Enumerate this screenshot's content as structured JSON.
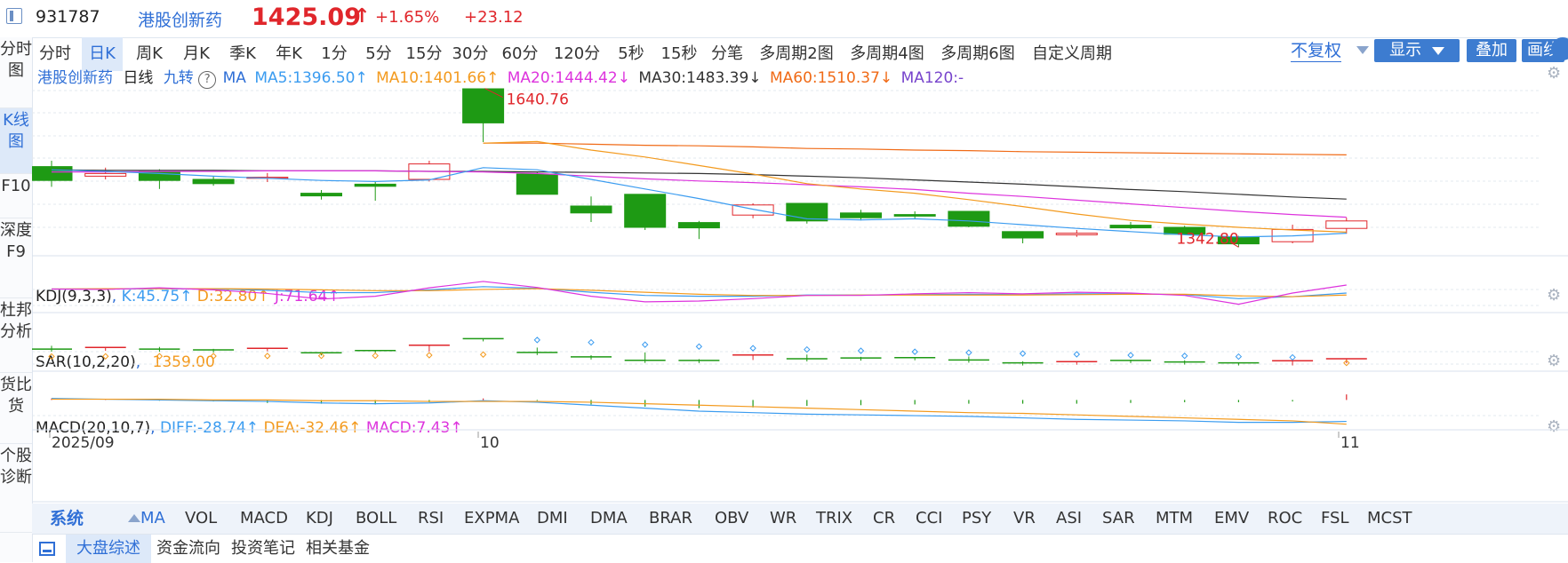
{
  "header": {
    "code": "931787",
    "name": "港股创新药",
    "price": "1425.09",
    "price_arrow": "↑",
    "change_pct": "+1.65%",
    "change_abs": "+23.12"
  },
  "left_nav": [
    "分时图",
    "K线图",
    "F10",
    "深度F9",
    "杜邦分析",
    "货比货",
    "个股诊断"
  ],
  "period_tabs": [
    "分时",
    "日K",
    "周K",
    "月K",
    "季K",
    "年K",
    "1分",
    "5分",
    "15分",
    "30分",
    "60分",
    "120分",
    "5秒",
    "15秒",
    "分笔",
    "多周期2图",
    "多周期4图",
    "多周期6图",
    "自定义周期"
  ],
  "active_period": "日K",
  "toolbar": {
    "fuquan": "不复权",
    "display": "显示",
    "overlay": "叠加",
    "draw": "画线"
  },
  "main_legend": {
    "name": "港股创新药",
    "period": "日线",
    "jiuzhuan": "九转",
    "help": "?",
    "ma": "MA",
    "ma5": "MA5:1396.50↑",
    "ma10": "MA10:1401.66↑",
    "ma20": "MA20:1444.42↓",
    "ma30": "MA30:1483.39↓",
    "ma60": "MA60:1510.37↓",
    "ma120": "MA120:-",
    "high_label": "1640.76",
    "low_label": "1342.80"
  },
  "kdj_legend": {
    "name": "KDJ(9,3,3)",
    "sep": ",",
    "k": "K:45.75↑",
    "d": "D:32.80↑",
    "j": "J:71.64↑"
  },
  "sar_legend": {
    "name": "SAR(10,2,20)",
    "sep": ",",
    "value": "1359.00"
  },
  "macd_legend": {
    "name": "MACD(20,10,7)",
    "sep": ",",
    "diff": "DIFF:-28.74↑",
    "dea": "DEA:-32.46↑",
    "macd": "MACD:7.43↑"
  },
  "x_axis": [
    "2025/09",
    "10",
    "11"
  ],
  "indicator_tabs": [
    "MA",
    "VOL",
    "MACD",
    "KDJ",
    "BOLL",
    "RSI",
    "EXPMA",
    "DMI",
    "DMA",
    "BRAR",
    "OBV",
    "WR",
    "TRIX",
    "CR",
    "CCI",
    "PSY",
    "VR",
    "ASI",
    "SAR",
    "MTM",
    "EMV",
    "ROC",
    "FSL",
    "MCST"
  ],
  "system_label": "系统",
  "bottom_tabs": [
    "大盘综述",
    "资金流向",
    "投资笔记",
    "相关基金"
  ],
  "colors": {
    "up": "#e0262b",
    "down": "#1e9a14",
    "ma5": "#3b9cf0",
    "ma10": "#f39a1e",
    "ma20": "#dd33dd",
    "ma30": "#333333",
    "ma60": "#f06a16",
    "ma120": "#7744cc",
    "accent": "#2f6fd6"
  },
  "chart_data": {
    "type": "candlestick",
    "price_range": [
      1330,
      1650
    ],
    "candles": [
      {
        "o": 1494,
        "h": 1505,
        "l": 1456,
        "c": 1468
      },
      {
        "o": 1476,
        "h": 1492,
        "l": 1470,
        "c": 1481
      },
      {
        "o": 1485,
        "h": 1489,
        "l": 1452,
        "c": 1468
      },
      {
        "o": 1470,
        "h": 1476,
        "l": 1458,
        "c": 1462
      },
      {
        "o": 1472,
        "h": 1482,
        "l": 1465,
        "c": 1474
      },
      {
        "o": 1444,
        "h": 1450,
        "l": 1432,
        "c": 1439
      },
      {
        "o": 1461,
        "h": 1465,
        "l": 1430,
        "c": 1457
      },
      {
        "o": 1470,
        "h": 1505,
        "l": 1466,
        "c": 1499
      },
      {
        "o": 1640,
        "h": 1640.76,
        "l": 1540,
        "c": 1576
      },
      {
        "o": 1480,
        "h": 1485,
        "l": 1442,
        "c": 1442
      },
      {
        "o": 1420,
        "h": 1438,
        "l": 1390,
        "c": 1407
      },
      {
        "o": 1442,
        "h": 1442,
        "l": 1375,
        "c": 1380
      },
      {
        "o": 1389,
        "h": 1392,
        "l": 1358,
        "c": 1379
      },
      {
        "o": 1403,
        "h": 1425,
        "l": 1397,
        "c": 1422
      },
      {
        "o": 1425,
        "h": 1425,
        "l": 1387,
        "c": 1392
      },
      {
        "o": 1407,
        "h": 1413,
        "l": 1393,
        "c": 1398
      },
      {
        "o": 1404,
        "h": 1410,
        "l": 1395,
        "c": 1401
      },
      {
        "o": 1410,
        "h": 1410,
        "l": 1380,
        "c": 1382
      },
      {
        "o": 1372,
        "h": 1372,
        "l": 1350,
        "c": 1360
      },
      {
        "o": 1366,
        "h": 1375,
        "l": 1362,
        "c": 1369
      },
      {
        "o": 1384,
        "h": 1390,
        "l": 1377,
        "c": 1379
      },
      {
        "o": 1380,
        "h": 1383,
        "l": 1367,
        "c": 1367
      },
      {
        "o": 1362,
        "h": 1364,
        "l": 1342.8,
        "c": 1349
      },
      {
        "o": 1353,
        "h": 1385,
        "l": 1350,
        "c": 1376
      },
      {
        "o": 1378,
        "h": 1398,
        "l": 1368,
        "c": 1392
      }
    ],
    "ma5": [
      1488,
      1485,
      1481,
      1476,
      1472,
      1468,
      1466,
      1469,
      1492,
      1488,
      1470,
      1452,
      1434,
      1414,
      1396,
      1394,
      1396,
      1392,
      1385,
      1378,
      1372,
      1366,
      1362,
      1364,
      1369
    ],
    "ma10": [
      null,
      null,
      null,
      null,
      null,
      null,
      null,
      null,
      1538,
      1541,
      1525,
      1512,
      1496,
      1480,
      1462,
      1452,
      1444,
      1432,
      1419,
      1405,
      1393,
      1386,
      1380,
      1375,
      1371
    ],
    "ma20": [
      1484,
      1484,
      1485,
      1485,
      1486,
      1486,
      1486,
      1485,
      1484,
      1481,
      1476,
      1471,
      1467,
      1464,
      1460,
      1456,
      1451,
      1444,
      1438,
      1431,
      1424,
      1417,
      1410,
      1404,
      1399
    ],
    "ma30": [
      1488,
      1487,
      1487,
      1487,
      1486,
      1486,
      1486,
      1485,
      1485,
      1484,
      1483,
      1482,
      1481,
      1479,
      1476,
      1473,
      1469,
      1465,
      1461,
      1456,
      1451,
      1447,
      1442,
      1437,
      1433
    ],
    "ma60": [
      null,
      null,
      null,
      null,
      null,
      null,
      null,
      null,
      1538,
      1538,
      1536,
      1534,
      1533,
      1531,
      1528,
      1527,
      1525,
      1524,
      1522,
      1521,
      1520,
      1519,
      1518,
      1517,
      1516
    ],
    "kdj_k": [
      70,
      70,
      71,
      70,
      67,
      61,
      61,
      68,
      76,
      72,
      62,
      54,
      52,
      52,
      55,
      55,
      56,
      57,
      56,
      58,
      58,
      56,
      46,
      51,
      60
    ],
    "kdj_d": [
      70,
      71,
      71,
      71,
      70,
      68,
      66,
      66,
      69,
      71,
      67,
      62,
      57,
      54,
      54,
      55,
      55,
      55,
      55,
      56,
      57,
      57,
      53,
      51,
      55
    ],
    "kdj_j": [
      70,
      69,
      73,
      68,
      59,
      45,
      52,
      73,
      89,
      74,
      52,
      38,
      40,
      46,
      54,
      54,
      58,
      61,
      58,
      62,
      60,
      54,
      32,
      60,
      80
    ],
    "sar": [
      1410,
      1411,
      1412,
      1413,
      1414,
      1415,
      1416,
      1420,
      1425,
      1540,
      1521,
      1503,
      1488,
      1475,
      1465,
      1455,
      1447,
      1440,
      1433,
      1427,
      1420,
      1415,
      1409,
      1403,
      1359
    ],
    "macd_diff": [
      2,
      1,
      0,
      -1,
      -2,
      -4,
      -5,
      -4,
      -1,
      -3,
      -7,
      -11,
      -15,
      -17,
      -19,
      -20,
      -21,
      -22,
      -24,
      -26,
      -27,
      -28,
      -30,
      -30,
      -28.74
    ],
    "macd_dea": [
      1,
      1,
      1,
      0,
      0,
      -1,
      -1,
      -2,
      -2,
      -2,
      -3,
      -5,
      -7,
      -9,
      -11,
      -13,
      -15,
      -17,
      -18,
      -20,
      -22,
      -24,
      -26,
      -28,
      -32.46
    ],
    "macd_hist": [
      2,
      1,
      -1,
      -2,
      -4,
      -5,
      -6,
      -3,
      2,
      -1,
      -6,
      -9,
      -11,
      -10,
      -8,
      -7,
      -6,
      -5,
      -5,
      -5,
      -4,
      -3,
      -3,
      -2,
      7.43
    ]
  }
}
